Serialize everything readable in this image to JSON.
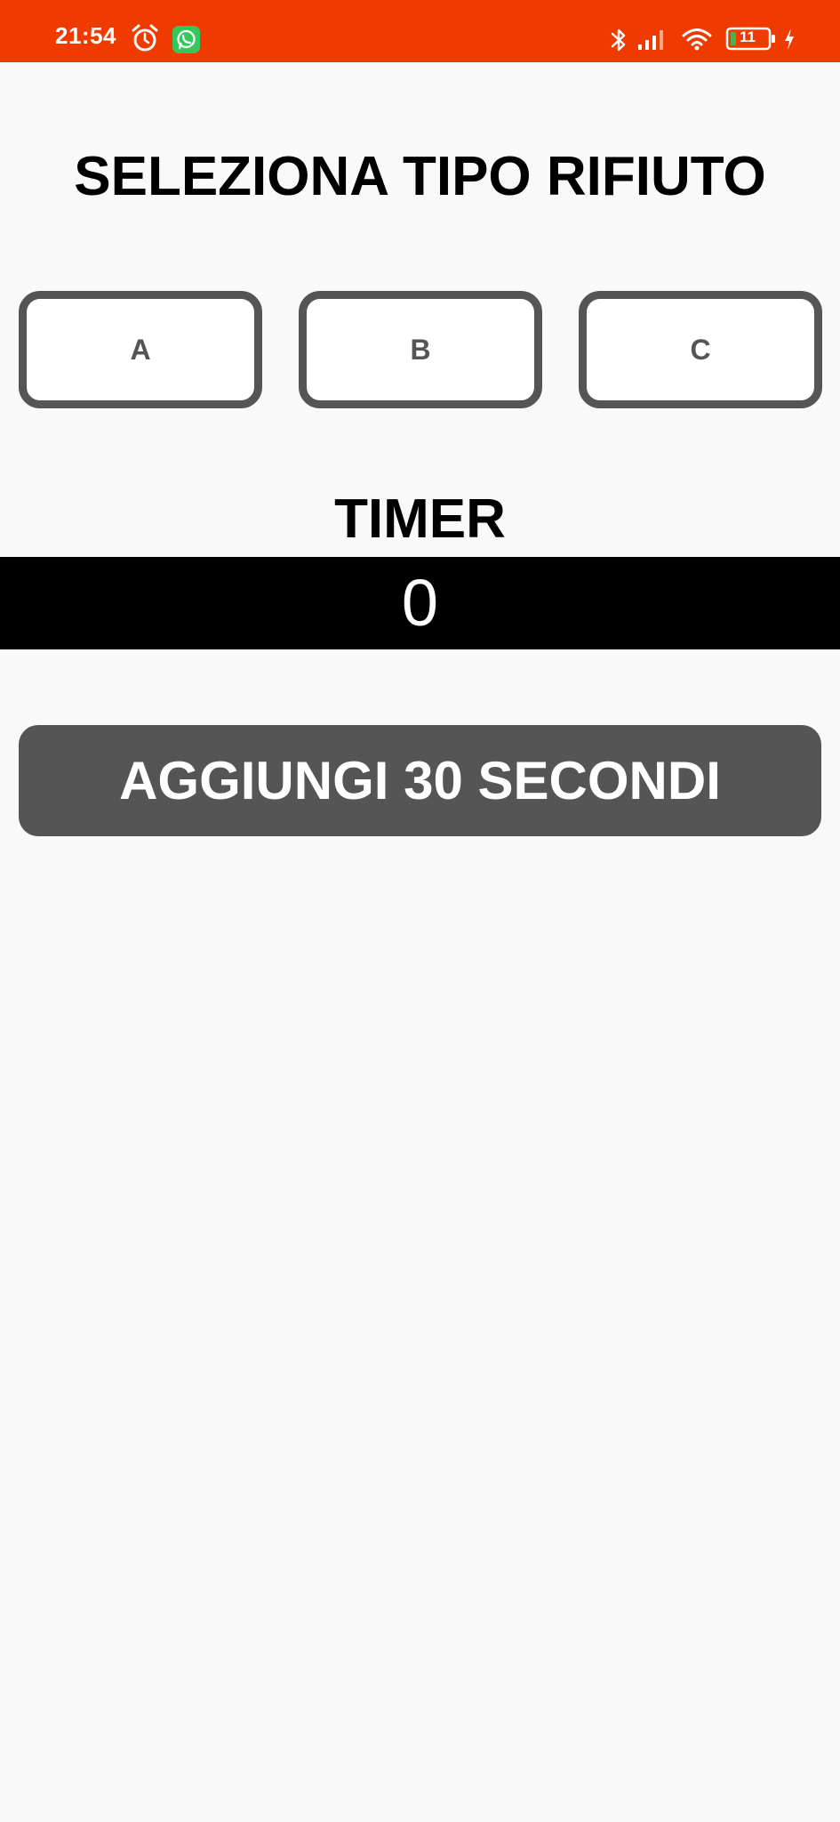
{
  "status_bar": {
    "time": "21:54",
    "battery_level": "11",
    "icons": [
      "alarm-icon",
      "whatsapp-icon",
      "bluetooth-icon",
      "signal-icon",
      "wifi-icon",
      "battery-icon",
      "charging-icon"
    ],
    "background_color": "#ef3b00"
  },
  "main": {
    "title": "SELEZIONA TIPO RIFIUTO",
    "type_buttons": [
      {
        "label": "A"
      },
      {
        "label": "B"
      },
      {
        "label": "C"
      }
    ],
    "timer_label": "TIMER",
    "timer_value": "0",
    "add_button_label": "AGGIUNGI 30 SECONDI"
  },
  "colors": {
    "background": "#f9f9f9",
    "button_border": "#555555",
    "add_button": "#555555",
    "timer_background": "#000000"
  }
}
